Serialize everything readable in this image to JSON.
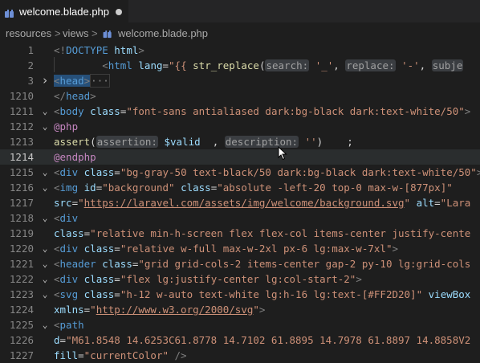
{
  "tab": {
    "label": "welcome.blade.php",
    "icon": "blade-file-icon"
  },
  "breadcrumb": {
    "items": [
      "resources",
      "views",
      "welcome.blade.php"
    ],
    "separator": ">"
  },
  "lines": [
    {
      "n": "1",
      "fold": "",
      "tokens": [
        [
          "t-ang",
          "<!"
        ],
        [
          "t-tag",
          "DOCTYPE"
        ],
        [
          "t-plain",
          " "
        ],
        [
          "t-attr",
          "html"
        ],
        [
          "t-ang",
          ">"
        ]
      ]
    },
    {
      "n": "2",
      "fold": "",
      "tokens": [
        [
          "t-plain",
          "        "
        ],
        [
          "t-ang",
          "<"
        ],
        [
          "t-tag",
          "html"
        ],
        [
          "t-plain",
          " "
        ],
        [
          "t-attr",
          "lang"
        ],
        [
          "t-plain",
          "="
        ],
        [
          "t-str",
          "\"{{ "
        ],
        [
          "t-fn",
          "str_replace"
        ],
        [
          "t-plain",
          "("
        ],
        [
          "hint",
          "search:"
        ],
        [
          "t-plain",
          " "
        ],
        [
          "t-str",
          "'_'"
        ],
        [
          "t-plain",
          ", "
        ],
        [
          "hint",
          "replace:"
        ],
        [
          "t-plain",
          " "
        ],
        [
          "t-str",
          "'-'"
        ],
        [
          "t-plain",
          ", "
        ],
        [
          "hint",
          "subje"
        ]
      ]
    },
    {
      "n": "3",
      "fold": ">",
      "tokens": [
        [
          "t-ang head-bg",
          "<"
        ],
        [
          "t-tag head-bg",
          "head"
        ],
        [
          "t-ang head-bg",
          ">"
        ],
        [
          "fold-box",
          "···"
        ]
      ]
    },
    {
      "n": "1210",
      "fold": "",
      "tokens": [
        [
          "t-ang",
          "</"
        ],
        [
          "t-tag",
          "head"
        ],
        [
          "t-ang",
          ">"
        ]
      ]
    },
    {
      "n": "1211",
      "fold": "v",
      "tokens": [
        [
          "t-ang",
          "<"
        ],
        [
          "t-tag",
          "body"
        ],
        [
          "t-plain",
          " "
        ],
        [
          "t-attr",
          "class"
        ],
        [
          "t-plain",
          "="
        ],
        [
          "t-str",
          "\"font-sans antialiased dark:bg-black dark:text-white/50\""
        ],
        [
          "t-ang",
          ">"
        ]
      ]
    },
    {
      "n": "1212",
      "fold": "v",
      "tokens": [
        [
          "t-dir",
          "@php"
        ]
      ]
    },
    {
      "n": "1213",
      "fold": "",
      "tokens": [
        [
          "t-fn",
          "assert"
        ],
        [
          "t-plain",
          "("
        ],
        [
          "hint",
          "assertion:"
        ],
        [
          "t-plain",
          " "
        ],
        [
          "t-var",
          "$valid"
        ],
        [
          "t-plain",
          "  , "
        ],
        [
          "hint",
          "description:"
        ],
        [
          "t-plain",
          " "
        ],
        [
          "t-str",
          "''"
        ],
        [
          "t-plain",
          ")    ;"
        ]
      ]
    },
    {
      "n": "1214",
      "fold": "",
      "current": true,
      "tokens": [
        [
          "t-dir",
          "@endphp"
        ]
      ]
    },
    {
      "n": "1215",
      "fold": "v",
      "tokens": [
        [
          "t-ang",
          "<"
        ],
        [
          "t-tag",
          "div"
        ],
        [
          "t-plain",
          " "
        ],
        [
          "t-attr",
          "class"
        ],
        [
          "t-plain",
          "="
        ],
        [
          "t-str",
          "\"bg-gray-50 text-black/50 dark:bg-black dark:text-white/50\""
        ],
        [
          "t-ang",
          ">"
        ]
      ]
    },
    {
      "n": "1216",
      "fold": "v",
      "tokens": [
        [
          "t-ang",
          "<"
        ],
        [
          "t-tag",
          "img"
        ],
        [
          "t-plain",
          " "
        ],
        [
          "t-attr",
          "id"
        ],
        [
          "t-plain",
          "="
        ],
        [
          "t-str",
          "\"background\""
        ],
        [
          "t-plain",
          " "
        ],
        [
          "t-attr",
          "class"
        ],
        [
          "t-plain",
          "="
        ],
        [
          "t-str",
          "\"absolute -left-20 top-0 max-w-[877px]\""
        ]
      ]
    },
    {
      "n": "1217",
      "fold": "",
      "tokens": [
        [
          "t-attr",
          "src"
        ],
        [
          "t-plain",
          "="
        ],
        [
          "t-str",
          "\""
        ],
        [
          "t-url",
          "https://laravel.com/assets/img/welcome/background.svg"
        ],
        [
          "t-str",
          "\""
        ],
        [
          "t-plain",
          " "
        ],
        [
          "t-attr",
          "alt"
        ],
        [
          "t-plain",
          "="
        ],
        [
          "t-str",
          "\"Lara"
        ]
      ]
    },
    {
      "n": "1218",
      "fold": "v",
      "tokens": [
        [
          "t-ang",
          "<"
        ],
        [
          "t-tag",
          "div"
        ]
      ]
    },
    {
      "n": "1219",
      "fold": "",
      "tokens": [
        [
          "t-attr",
          "class"
        ],
        [
          "t-plain",
          "="
        ],
        [
          "t-str",
          "\"relative min-h-screen flex flex-col items-center justify-cente"
        ]
      ]
    },
    {
      "n": "1220",
      "fold": "v",
      "tokens": [
        [
          "t-ang",
          "<"
        ],
        [
          "t-tag",
          "div"
        ],
        [
          "t-plain",
          " "
        ],
        [
          "t-attr",
          "class"
        ],
        [
          "t-plain",
          "="
        ],
        [
          "t-str",
          "\"relative w-full max-w-2xl px-6 lg:max-w-7xl\""
        ],
        [
          "t-ang",
          ">"
        ]
      ]
    },
    {
      "n": "1221",
      "fold": "v",
      "tokens": [
        [
          "t-ang",
          "<"
        ],
        [
          "t-tag",
          "header"
        ],
        [
          "t-plain",
          " "
        ],
        [
          "t-attr",
          "class"
        ],
        [
          "t-plain",
          "="
        ],
        [
          "t-str",
          "\"grid grid-cols-2 items-center gap-2 py-10 lg:grid-cols"
        ]
      ]
    },
    {
      "n": "1222",
      "fold": "v",
      "tokens": [
        [
          "t-ang",
          "<"
        ],
        [
          "t-tag",
          "div"
        ],
        [
          "t-plain",
          " "
        ],
        [
          "t-attr",
          "class"
        ],
        [
          "t-plain",
          "="
        ],
        [
          "t-str",
          "\"flex lg:justify-center lg:col-start-2\""
        ],
        [
          "t-ang",
          ">"
        ]
      ]
    },
    {
      "n": "1223",
      "fold": "v",
      "tokens": [
        [
          "t-ang",
          "<"
        ],
        [
          "t-tag",
          "svg"
        ],
        [
          "t-plain",
          " "
        ],
        [
          "t-attr",
          "class"
        ],
        [
          "t-plain",
          "="
        ],
        [
          "t-str",
          "\"h-12 w-auto text-white lg:h-16 lg:text-[#FF2D20]\""
        ],
        [
          "t-plain",
          " "
        ],
        [
          "t-attr",
          "viewBox"
        ]
      ]
    },
    {
      "n": "1224",
      "fold": "",
      "tokens": [
        [
          "t-attr",
          "xmlns"
        ],
        [
          "t-plain",
          "="
        ],
        [
          "t-str",
          "\""
        ],
        [
          "t-url",
          "http://www.w3.org/2000/svg"
        ],
        [
          "t-str",
          "\""
        ],
        [
          "t-ang",
          ">"
        ]
      ]
    },
    {
      "n": "1225",
      "fold": "v",
      "tokens": [
        [
          "t-ang",
          "<"
        ],
        [
          "t-tag",
          "path"
        ]
      ]
    },
    {
      "n": "1226",
      "fold": "",
      "tokens": [
        [
          "t-attr",
          "d"
        ],
        [
          "t-plain",
          "="
        ],
        [
          "t-str",
          "\"M61.8548 14.6253C61.8778 14.7102 61.8895 14.7978 61.8897 14.8858V2"
        ]
      ]
    },
    {
      "n": "1227",
      "fold": "",
      "tokens": [
        [
          "t-attr",
          "fill"
        ],
        [
          "t-plain",
          "="
        ],
        [
          "t-str",
          "\"currentColor\""
        ],
        [
          "t-plain",
          " "
        ],
        [
          "t-ang",
          "/>"
        ]
      ]
    }
  ],
  "colors": {
    "accent_tab_icon": "#6d8fd6",
    "background": "#1e1e1e"
  }
}
